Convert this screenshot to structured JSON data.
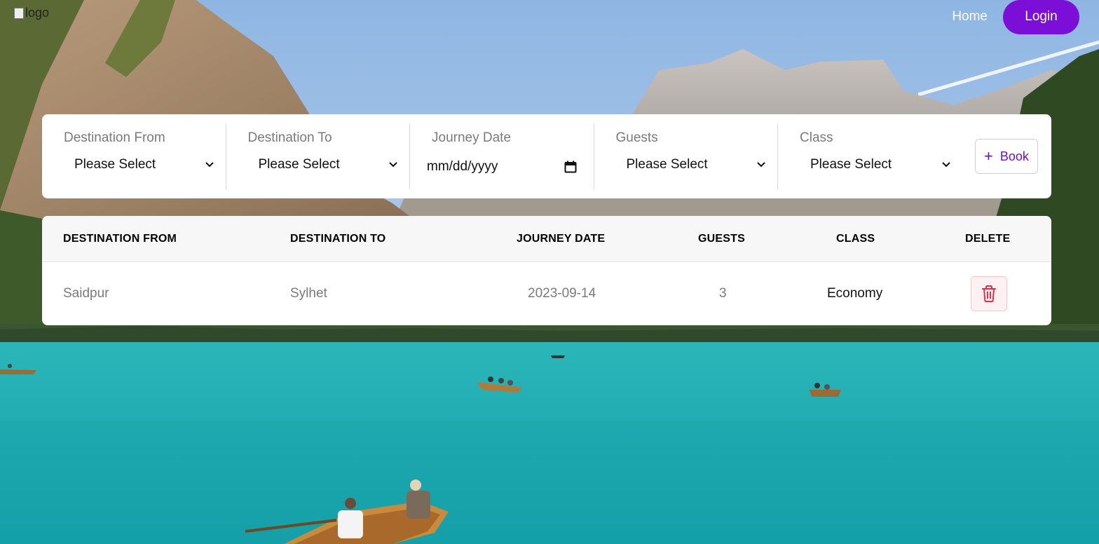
{
  "header": {
    "logo_alt": "logo",
    "nav_home": "Home",
    "nav_login": "Login"
  },
  "booking_form": {
    "fields": [
      {
        "label": "Destination From",
        "value": "Please Select"
      },
      {
        "label": "Destination To",
        "value": "Please Select"
      },
      {
        "label": "Journey Date",
        "value": "mm/dd/yyyy"
      },
      {
        "label": "Guests",
        "value": "Please Select"
      },
      {
        "label": "Class",
        "value": "Please Select"
      }
    ],
    "book_label": "Book"
  },
  "bookings_table": {
    "headers": [
      "DESTINATION FROM",
      "DESTINATION TO",
      "JOURNEY DATE",
      "GUESTS",
      "CLASS",
      "DELETE"
    ],
    "rows": [
      {
        "from": "Saidpur",
        "to": "Sylhet",
        "date": "2023-09-14",
        "guests": "3",
        "class": "Economy"
      }
    ]
  },
  "colors": {
    "accent": "#7b0fd8",
    "book_text": "#6a12c8",
    "delete_icon": "#e0304a",
    "delete_bg": "#fff1f3"
  }
}
